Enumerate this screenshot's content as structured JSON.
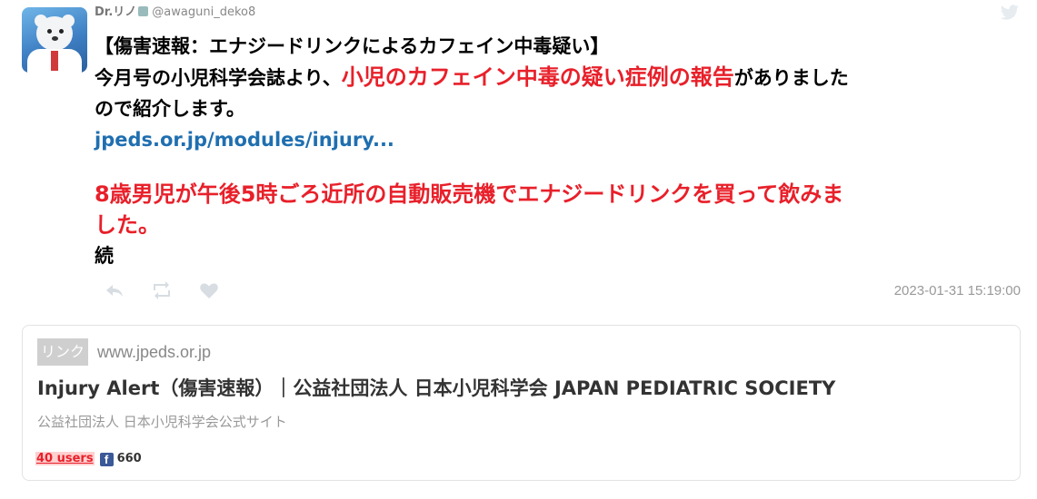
{
  "tweet": {
    "display_name": "Dr.リノ",
    "handle": "@awaguni_deko8",
    "line1": "【傷害速報：エナジードリンクによるカフェイン中毒疑い】",
    "line2_pre": "今月号の小児科学会誌より、",
    "line2_red": "小児のカフェイン中毒の疑い症例の報告",
    "line2_post": "がありました",
    "line3": "ので紹介します。",
    "link_text": "jpeds.or.jp/modules/injury...",
    "red_line1": "8歳男児が午後5時ごろ近所の自動販売機でエナジードリンクを買って飲みま",
    "red_line2": "した。",
    "continued": "続",
    "timestamp": "2023-01-31 15:19:00"
  },
  "card": {
    "tag": "リンク",
    "domain": "www.jpeds.or.jp",
    "title": "Injury Alert（傷害速報）｜公益社団法人 日本小児科学会 JAPAN PEDIATRIC SOCIETY",
    "description": "公益社団法人 日本小児科学会公式サイト",
    "users": "40 users",
    "facebook_count": "660"
  },
  "icons": [
    "avatar",
    "twitter-bird-icon",
    "reply-icon",
    "retweet-icon",
    "like-icon",
    "facebook-icon"
  ],
  "colors": {
    "accent_red": "#e8202a",
    "link_blue": "#1f6fb0",
    "facebook_blue": "#3b5998"
  }
}
